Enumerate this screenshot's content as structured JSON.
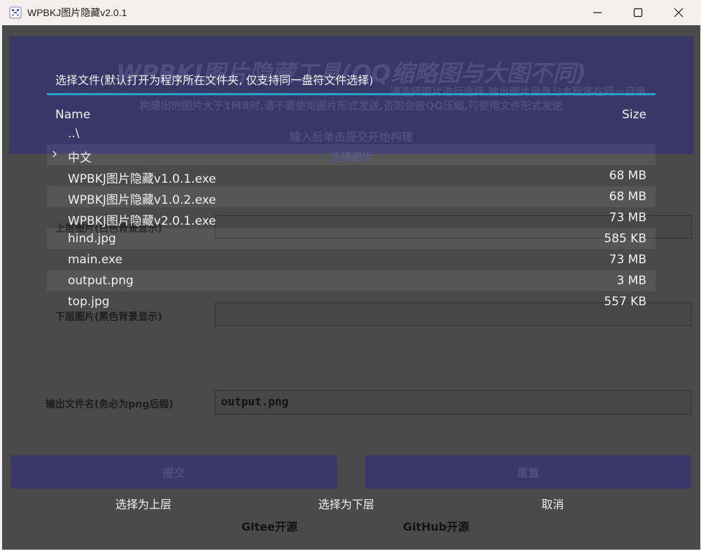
{
  "window": {
    "title": "WPBKJ图片隐藏v2.0.1"
  },
  "app": {
    "title": "WPBKJ图片隐藏工具(QQ缩略图与大图不同)",
    "description_line1": "请选择图片进行选择,输出图片目录与本程序在同一目录",
    "description_line2": "构建出的图片大于1MB时,请不要使用图片形式发送,否则会被QQ压缩,可使用文件形式发送",
    "submit_hint": "输入后单击提交开始构建",
    "choose_image": "选择图片",
    "upper_label": "上层图片(白色背景显示)",
    "upper_value": "",
    "lower_label": "下层图片(黑色背景显示)",
    "lower_value": "",
    "output_label": "输出文件名(务必为png后缀)",
    "output_value": "output.png",
    "submit_label": "提交",
    "reset_label": "重置",
    "gitee_label": "Gitee开源",
    "github_label": "GitHub开源"
  },
  "file_chooser": {
    "prompt": "选择文件(默认打开为程序所在文件夹, 仅支持同一盘符文件选择)",
    "col_name": "Name",
    "col_size": "Size",
    "rows": [
      {
        "name": "..\\",
        "size": "",
        "type": "parent"
      },
      {
        "name": "中文",
        "size": "",
        "type": "folder"
      },
      {
        "name": "WPBKJ图片隐藏v1.0.1.exe",
        "size": "68 MB",
        "type": "file"
      },
      {
        "name": "WPBKJ图片隐藏v1.0.2.exe",
        "size": "68 MB",
        "type": "file"
      },
      {
        "name": "WPBKJ图片隐藏v2.0.1.exe",
        "size": "73 MB",
        "type": "file"
      },
      {
        "name": "hind.jpg",
        "size": "585 KB",
        "type": "file"
      },
      {
        "name": "main.exe",
        "size": "73 MB",
        "type": "file"
      },
      {
        "name": "output.png",
        "size": "3 MB",
        "type": "file"
      },
      {
        "name": "top.jpg",
        "size": "557 KB",
        "type": "file"
      }
    ],
    "select_upper": "选择为上层",
    "select_lower": "选择为下层",
    "cancel": "取消"
  },
  "colors": {
    "accent_underline": "#28a3c8",
    "header_panel": "#373768",
    "dim_background": "#4a4a4a"
  }
}
